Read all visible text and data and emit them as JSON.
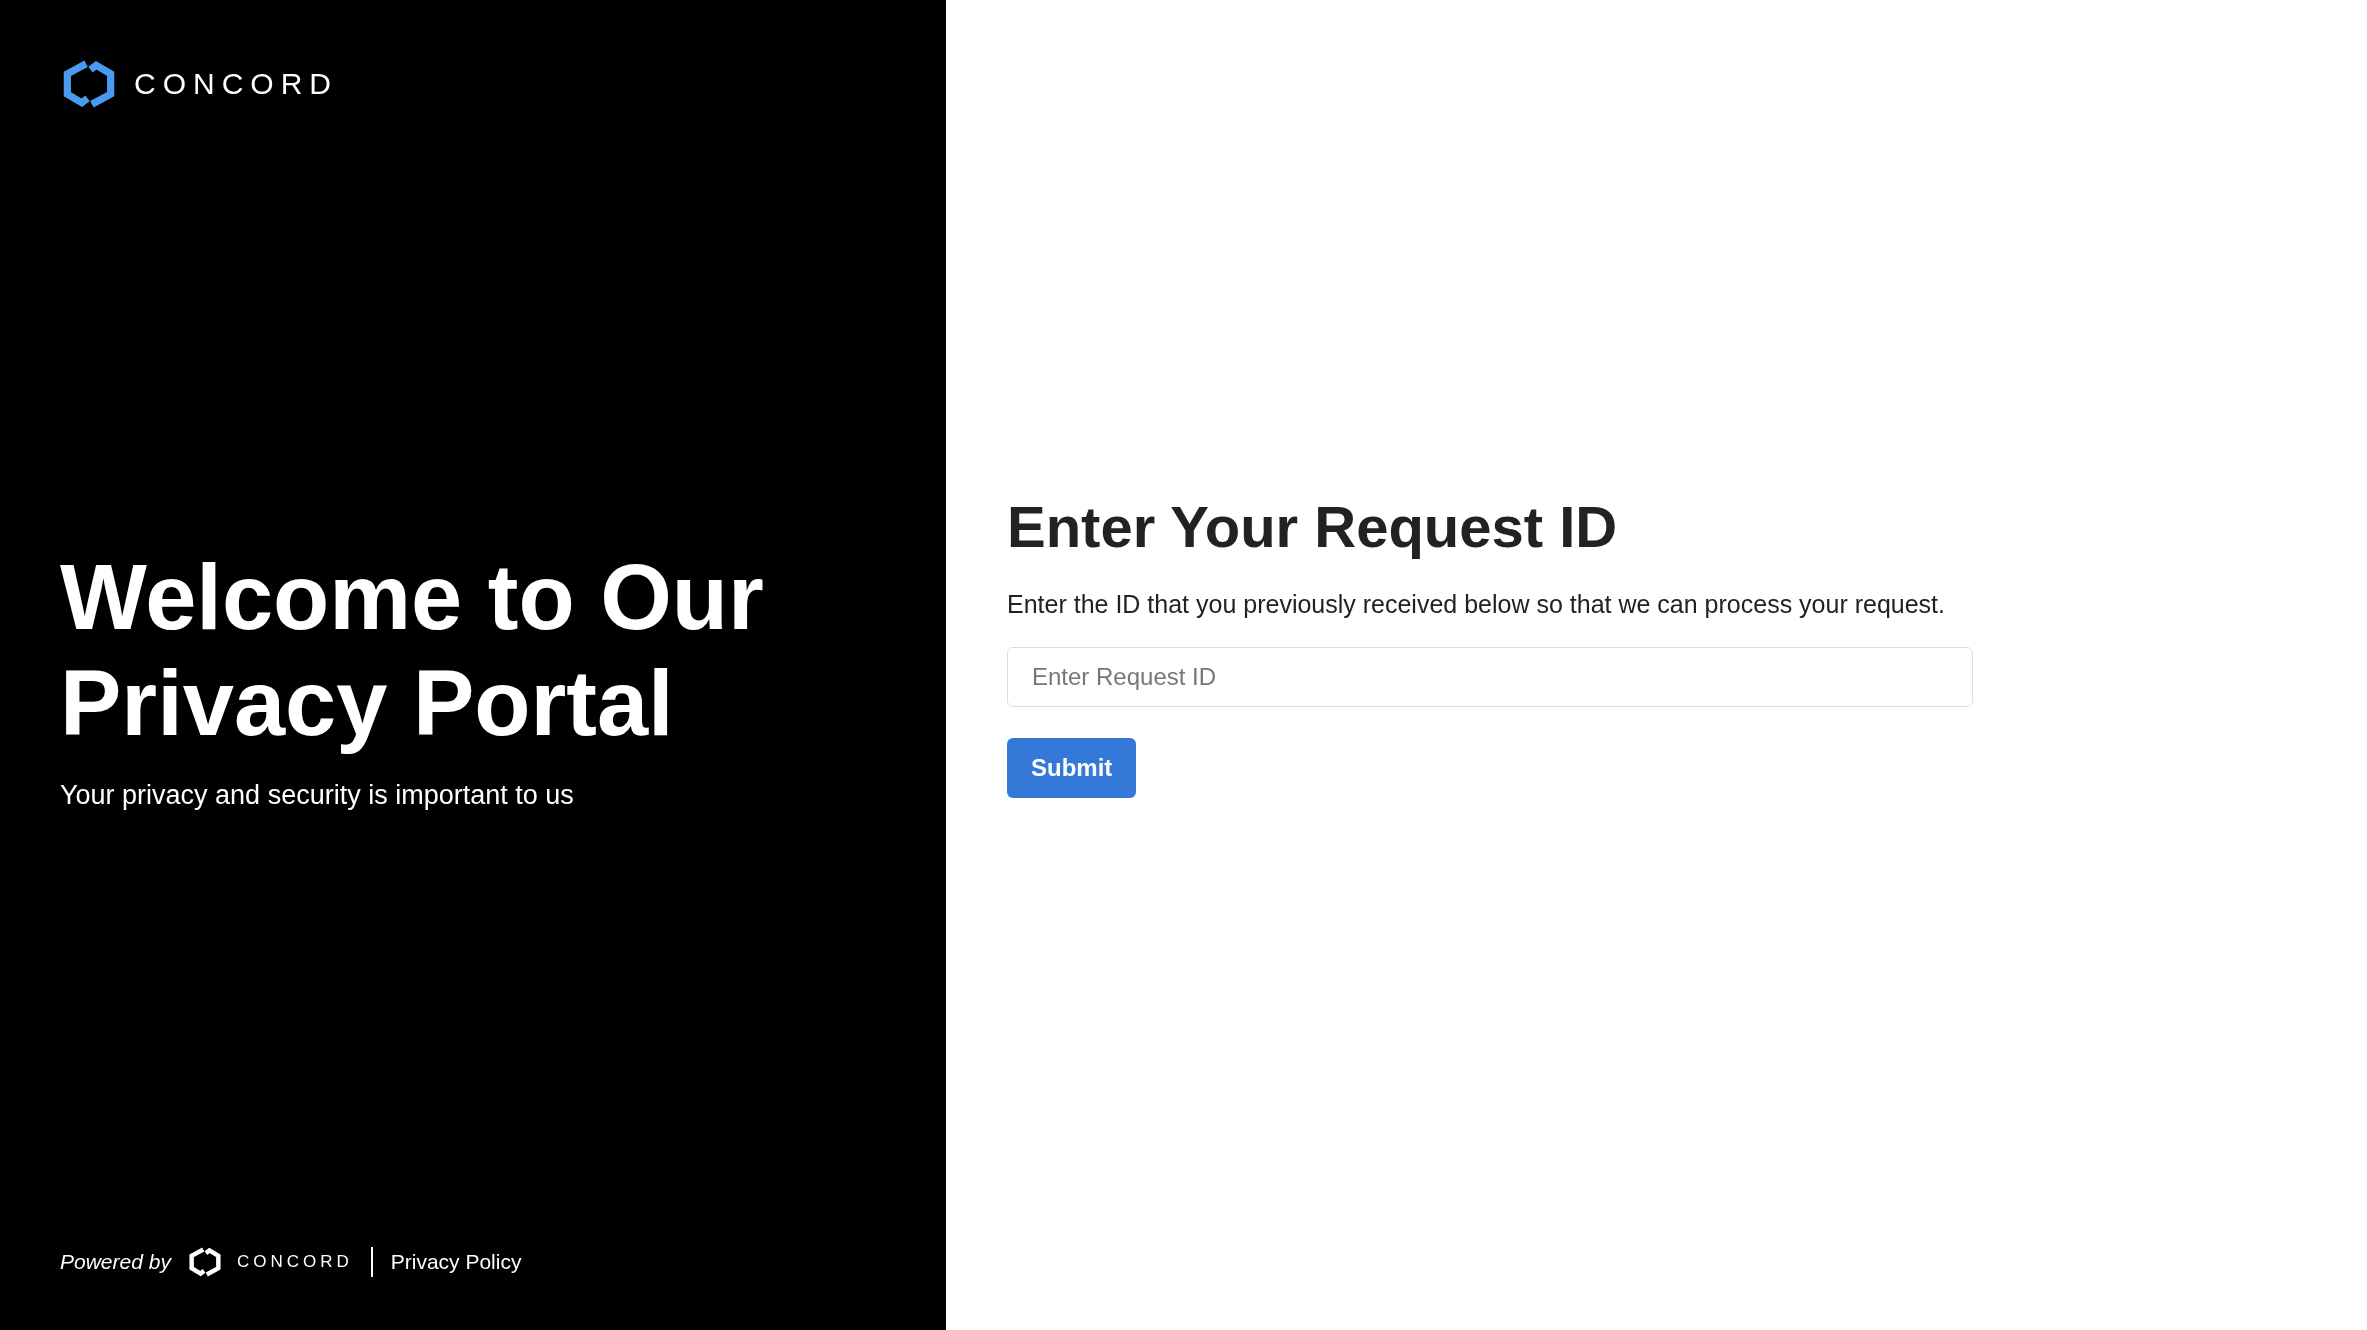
{
  "brand": {
    "name": "CONCORD"
  },
  "hero": {
    "title": "Welcome to Our Privacy Portal",
    "subtitle": "Your privacy and security is important to us"
  },
  "footer": {
    "powered_by": "Powered by",
    "brand_name": "CONCORD",
    "link": "Privacy Policy"
  },
  "form": {
    "title": "Enter Your Request ID",
    "description": "Enter the ID that you previously received below so that we can process your request.",
    "field": {
      "placeholder": "Enter Request ID"
    },
    "submit": "Submit"
  }
}
